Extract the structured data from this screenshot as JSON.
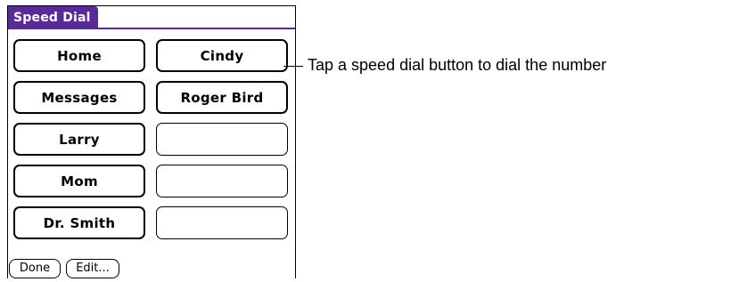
{
  "window": {
    "title": "Speed Dial"
  },
  "speed_dial_buttons": [
    {
      "label": "Home"
    },
    {
      "label": "Cindy"
    },
    {
      "label": "Messages"
    },
    {
      "label": "Roger Bird"
    },
    {
      "label": "Larry"
    },
    {
      "label": ""
    },
    {
      "label": "Mom"
    },
    {
      "label": ""
    },
    {
      "label": "Dr. Smith"
    },
    {
      "label": ""
    }
  ],
  "bottom_buttons": {
    "done_label": "Done",
    "edit_label": "Edit..."
  },
  "callout": {
    "text": "Tap a speed dial button to dial the number"
  },
  "colors": {
    "title_accent": "#5a2a96"
  }
}
